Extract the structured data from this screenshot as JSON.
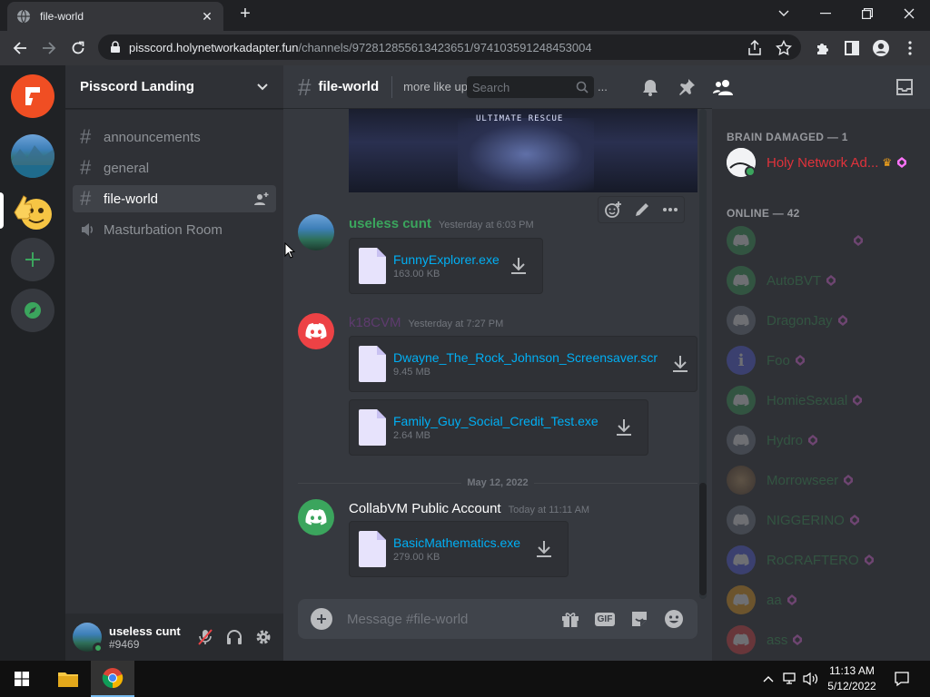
{
  "browser": {
    "tab_title": "file-world",
    "url_host": "pisscord.holynetworkadapter.fun",
    "url_path": "/channels/972812855613423651/974103591248453004"
  },
  "server": {
    "name": "Pisscord Landing",
    "channels": [
      {
        "name": "announcements",
        "type": "text"
      },
      {
        "name": "general",
        "type": "text"
      },
      {
        "name": "file-world",
        "type": "text",
        "active": true
      },
      {
        "name": "Masturbation Room",
        "type": "voice"
      }
    ]
  },
  "chat": {
    "channel_name": "file-world",
    "topic": "more like upload memz and run it on ...",
    "search_placeholder": "Search",
    "embed_caption": "ULTIMATE RESCUE",
    "messages": [
      {
        "author": "useless cunt",
        "author_color": "#3ba55d",
        "time": "Yesterday at 6:03 PM",
        "attachments": [
          {
            "name": "FunnyExplorer.exe",
            "size": "163.00 KB"
          }
        ]
      },
      {
        "author": "k18CVM",
        "author_color": "#5e3b6e",
        "time": "Yesterday at 7:27 PM",
        "attachments": [
          {
            "name": "Dwayne_The_Rock_Johnson_Screensaver.scr",
            "size": "9.45 MB"
          },
          {
            "name": "Family_Guy_Social_Credit_Test.exe",
            "size": "2.64 MB"
          }
        ]
      },
      {
        "author": "CollabVM Public Account",
        "author_color": "#ffffff",
        "time": "Today at 11:11 AM",
        "attachments": [
          {
            "name": "BasicMathematics.exe",
            "size": "279.00 KB"
          }
        ]
      }
    ],
    "date_divider": "May 12, 2022",
    "composer_placeholder": "Message #file-world",
    "gif_label": "GIF"
  },
  "user_panel": {
    "name": "useless cunt",
    "tag": "#9469"
  },
  "members": {
    "groups": [
      {
        "label": "BRAIN DAMAGED — 1"
      },
      {
        "label": "ONLINE — 42"
      }
    ],
    "list": [
      {
        "name": "Holy Network Ad...",
        "color": "#e0323b"
      },
      {
        "name": "",
        "color": "#2d7d46"
      },
      {
        "name": "AutoBVT",
        "color": "#3ba55d"
      },
      {
        "name": "DragonJay",
        "color": "#3ba55d"
      },
      {
        "name": "Foo",
        "color": "#3ba55d"
      },
      {
        "name": "HomieSexual",
        "color": "#3ba55d"
      },
      {
        "name": "Hydro",
        "color": "#3ba55d"
      },
      {
        "name": "Morrowseer",
        "color": "#3ba55d"
      },
      {
        "name": "NIGGERINO",
        "color": "#3ba55d"
      },
      {
        "name": "RoCRAFTERO",
        "color": "#3ba55d"
      },
      {
        "name": "aa",
        "color": "#3ba55d"
      },
      {
        "name": "ass",
        "color": "#3ba55d"
      }
    ]
  },
  "taskbar": {
    "time": "11:13 AM",
    "date": "5/12/2022"
  },
  "colors": {
    "blurple": "#5865f2",
    "green": "#3ba55d",
    "link": "#00aff4",
    "red": "#ed4245"
  }
}
